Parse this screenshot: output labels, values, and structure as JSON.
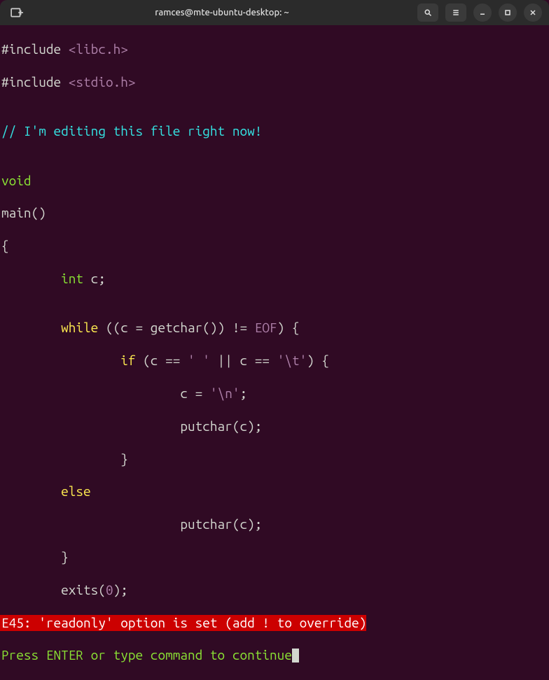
{
  "window": {
    "title": "ramces@mte-ubuntu-desktop: ~"
  },
  "code": {
    "l1a": "#include",
    "l1b": " <libc.h>",
    "l2a": "#include",
    "l2b": " <stdio.h>",
    "l3": "",
    "l4": "// I'm editing this file right now!",
    "l5": "",
    "l6": "void",
    "l7a": "main",
    "l7b": "()",
    "l8": "{",
    "l9a": "        ",
    "l9b": "int",
    "l9c": " c;",
    "l10": "",
    "l11a": "        ",
    "l11b": "while",
    "l11c": " ((c = getchar()) != ",
    "l11d": "EOF",
    "l11e": ") {",
    "l12a": "                ",
    "l12b": "if",
    "l12c": " (c == ",
    "l12d": "' '",
    "l12e": " || c == ",
    "l12f": "'\\t'",
    "l12g": ") {",
    "l13a": "                        c = ",
    "l13b": "'\\n'",
    "l13c": ";",
    "l14": "                        putchar(c);",
    "l15": "                }",
    "l16a": "        ",
    "l16b": "else",
    "l17": "                        putchar(c);",
    "l18": "        }",
    "l19a": "        exits(",
    "l19b": "0",
    "l19c": ");"
  },
  "error": "E45: 'readonly' option is set (add ! to override)",
  "prompt": "Press ENTER or type command to continue"
}
